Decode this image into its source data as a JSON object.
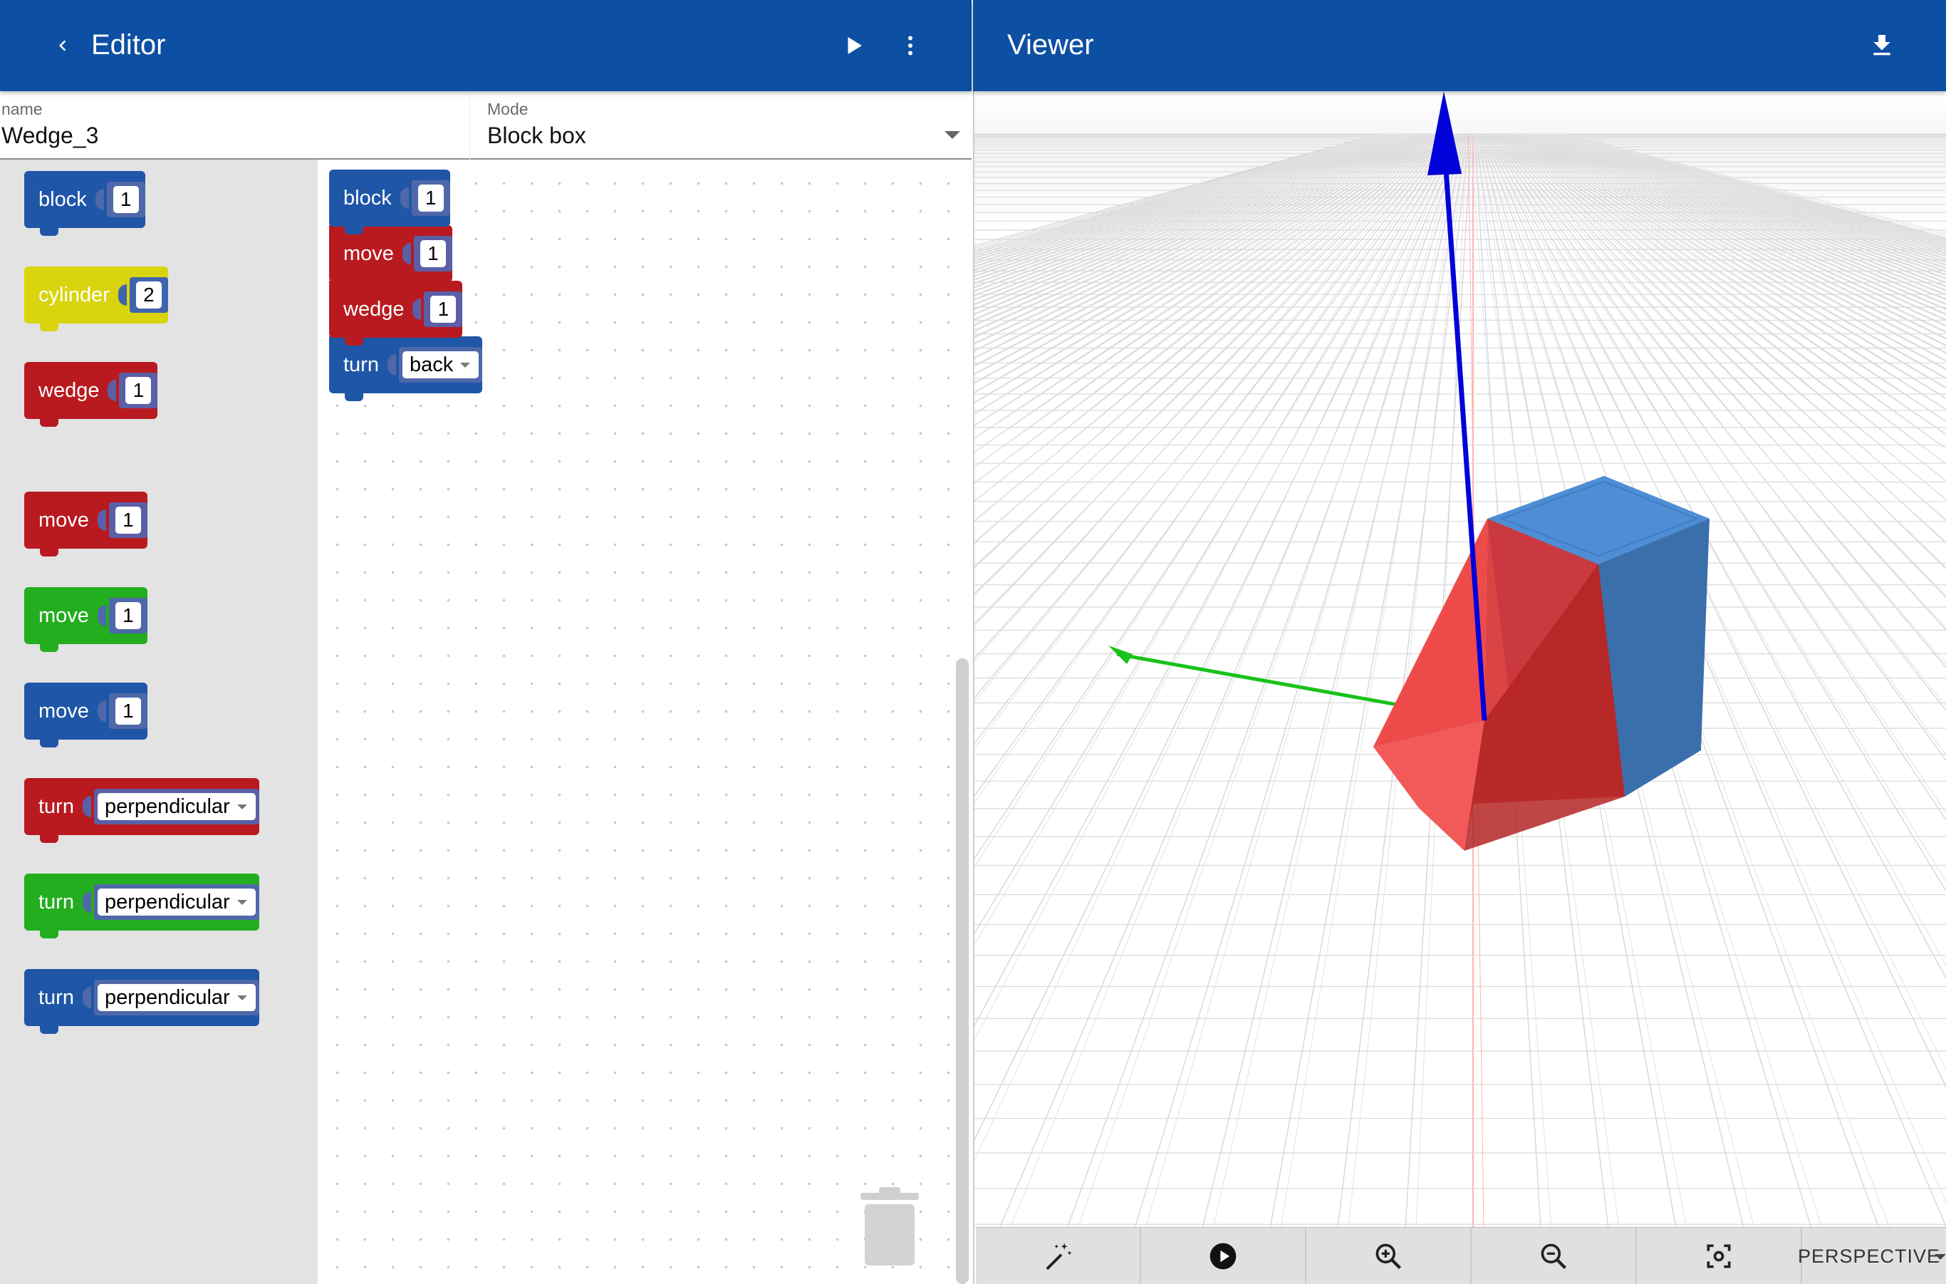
{
  "editor": {
    "title": "Editor",
    "name_label": "name",
    "name_value": "Wedge_3",
    "mode_label": "Mode",
    "mode_value": "Block box"
  },
  "viewer": {
    "title": "Viewer",
    "projection": "PERSPECTIVE"
  },
  "toolbox": [
    {
      "keyword": "block",
      "color": "blue",
      "value": "1"
    },
    {
      "keyword": "cylinder",
      "color": "yellow",
      "value": "2"
    },
    {
      "keyword": "wedge",
      "color": "red",
      "value": "1"
    },
    {
      "keyword": "move",
      "color": "red",
      "value": "1"
    },
    {
      "keyword": "move",
      "color": "green",
      "value": "1"
    },
    {
      "keyword": "move",
      "color": "blue",
      "value": "1"
    },
    {
      "keyword": "turn",
      "color": "red",
      "value": "perpendicular"
    },
    {
      "keyword": "turn",
      "color": "green",
      "value": "perpendicular"
    },
    {
      "keyword": "turn",
      "color": "blue",
      "value": "perpendicular"
    }
  ],
  "program": [
    {
      "keyword": "block",
      "color": "blue",
      "value": "1"
    },
    {
      "keyword": "move",
      "color": "red",
      "value": "1"
    },
    {
      "keyword": "wedge",
      "color": "red",
      "value": "1"
    },
    {
      "keyword": "turn",
      "color": "blue",
      "value": "back"
    }
  ],
  "icons": {
    "back": "chevron-left-icon",
    "run": "play-icon",
    "menu": "more-vert-icon",
    "download": "download-icon",
    "trash": "trash-icon",
    "wand": "magic-wand-icon",
    "animate": "play-circle-icon",
    "zoom_in": "zoom-in-icon",
    "zoom_out": "zoom-out-icon",
    "fit": "center-focus-icon"
  },
  "colors": {
    "appbar": "#0d4fa2",
    "block_blue": "#1f56a7",
    "block_red": "#b81a1f",
    "block_green": "#22ae1e",
    "block_yellow": "#d9d40e"
  }
}
